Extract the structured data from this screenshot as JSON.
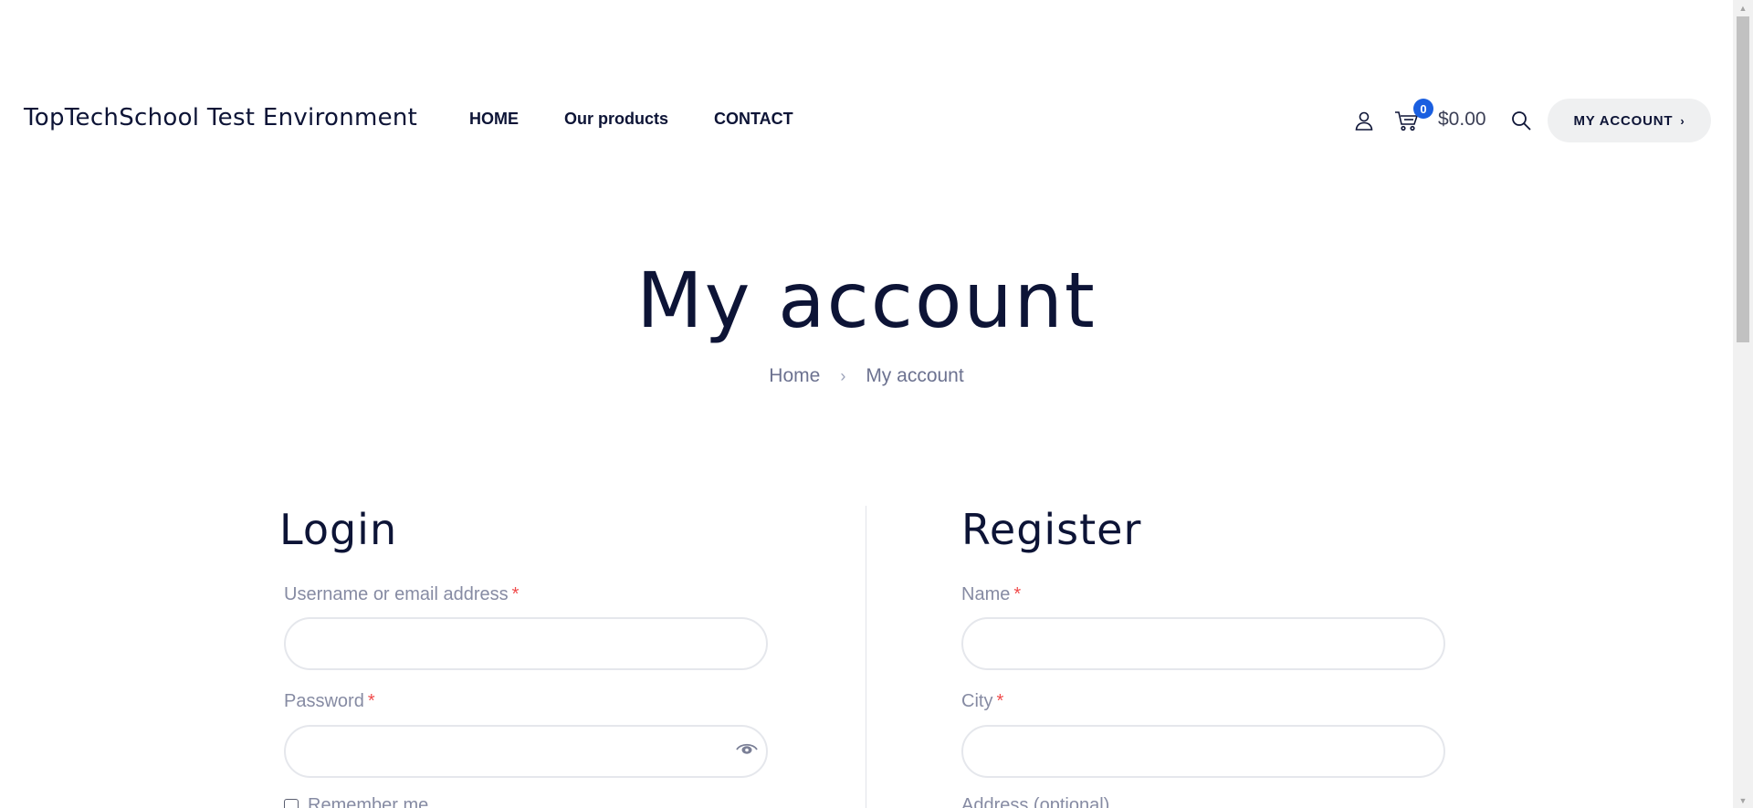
{
  "header": {
    "site_title": "TopTechSchool Test Environment",
    "nav": [
      {
        "label": "HOME"
      },
      {
        "label": "Our products"
      },
      {
        "label": "CONTACT"
      }
    ],
    "cart": {
      "count": "0",
      "total": "$0.00"
    },
    "account_button": {
      "label": "MY ACCOUNT",
      "chevron": "›"
    },
    "icons": {
      "user": "user-icon",
      "cart": "cart-icon",
      "search": "search-icon"
    }
  },
  "hero": {
    "title": "My account",
    "breadcrumb": {
      "home": "Home",
      "separator": "›",
      "current": "My account"
    }
  },
  "login": {
    "title": "Login",
    "username_label": "Username or email address",
    "username_value": "",
    "password_label": "Password",
    "password_value": "",
    "required_marker": "*",
    "remember_label": "Remember me",
    "remember_checked": false
  },
  "register": {
    "title": "Register",
    "name_label": "Name",
    "name_value": "",
    "city_label": "City",
    "city_value": "",
    "address_label": "Address (optional)",
    "required_marker": "*"
  },
  "colors": {
    "primary_text": "#0d1436",
    "muted_text": "#868ba3",
    "required": "#f04b4b",
    "badge": "#1a5fe0",
    "button_bg": "#eff0f1"
  }
}
